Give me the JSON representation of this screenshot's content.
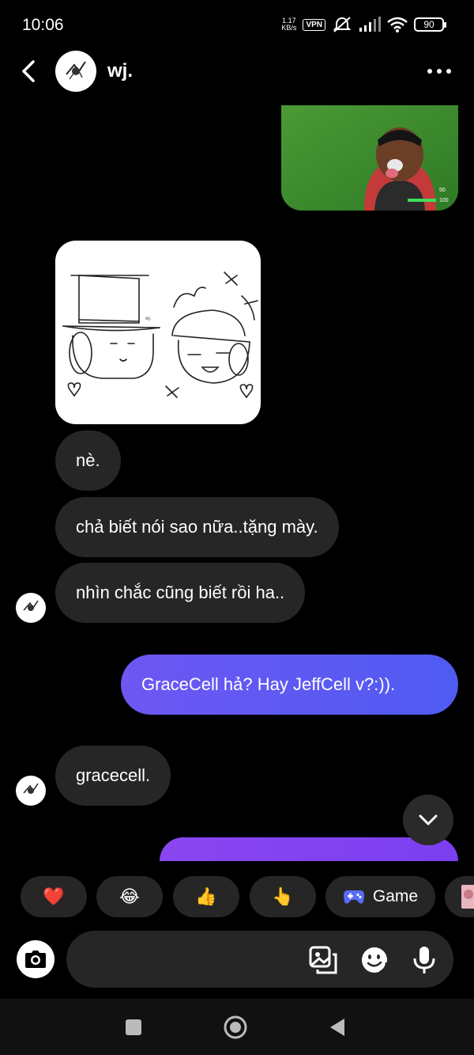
{
  "status_bar": {
    "time": "10:06",
    "speed_value": "1.17",
    "speed_unit": "KB/s",
    "vpn": "VPN",
    "battery": "90"
  },
  "header": {
    "contact_name": "wj."
  },
  "messages": [
    {
      "sender": "other",
      "kind": "image",
      "content": "sketch drawing"
    },
    {
      "sender": "other",
      "kind": "text",
      "text": "nè."
    },
    {
      "sender": "other",
      "kind": "text",
      "text": "chả biết nói sao nữa..tặng mày."
    },
    {
      "sender": "other",
      "kind": "text",
      "text": "nhìn chắc cũng biết rồi ha.."
    },
    {
      "sender": "me",
      "kind": "text",
      "text": "GraceCell hả? Hay JeffCell v?:))."
    },
    {
      "sender": "other",
      "kind": "text",
      "text": "gracecell."
    }
  ],
  "top_media": {
    "overlay_values": [
      "50",
      "100"
    ]
  },
  "sketch": {
    "tag": "wj."
  },
  "quick_reactions": [
    {
      "emoji": "❤️",
      "icon": "heart-icon"
    },
    {
      "emoji": "😂",
      "icon": "laughing-face-icon"
    },
    {
      "emoji": "👍",
      "icon": "thumbs-up-icon"
    },
    {
      "emoji": "👆",
      "icon": "pointing-hand-icon"
    },
    {
      "label": "Game",
      "icon": "gamepad-icon"
    }
  ],
  "composer": {
    "placeholder": ""
  },
  "colors": {
    "background": "#000000",
    "bubble_other": "#262626",
    "bubble_mine_start": "#6e57f3",
    "bubble_mine_end": "#4f5bf2",
    "accent_purple": "#8a46f0"
  }
}
